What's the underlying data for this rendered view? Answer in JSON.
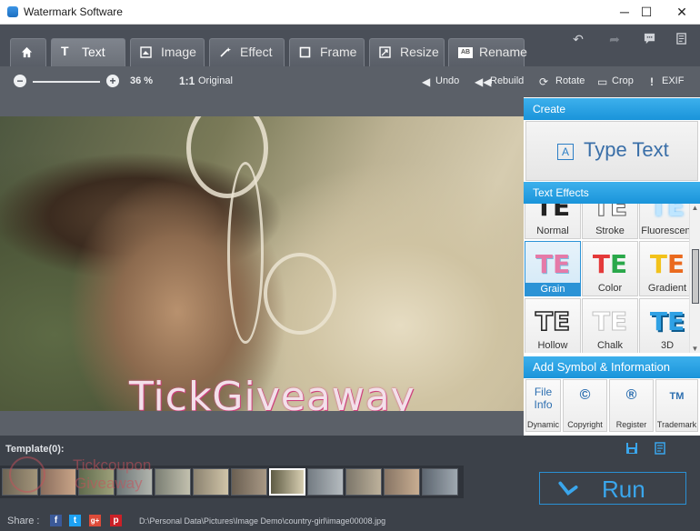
{
  "window": {
    "title": "Watermark Software",
    "minimize": "─",
    "maximize": "☐",
    "close": "✕"
  },
  "tabs": [
    {
      "label": "Text"
    },
    {
      "label": "Image"
    },
    {
      "label": "Effect"
    },
    {
      "label": "Frame"
    },
    {
      "label": "Resize"
    },
    {
      "label": "Rename"
    }
  ],
  "toolbar": {
    "zoom_percent": "36 %",
    "original_icon": "1:1",
    "original": "Original",
    "undo": "Undo",
    "rebuild": "Rebuild",
    "rotate": "Rotate",
    "crop": "Crop",
    "exif": "EXIF"
  },
  "canvas": {
    "watermark_text": "TickGiveaway"
  },
  "panel": {
    "create_head": "Create",
    "type_text_icon": "A",
    "type_text": "Type Text",
    "effects_head": "Text Effects",
    "effect_glyph": "TE",
    "effects": [
      {
        "label": "Normal"
      },
      {
        "label": "Stroke"
      },
      {
        "label": "Fluorescent"
      },
      {
        "label": "Grain"
      },
      {
        "label": "Color"
      },
      {
        "label": "Gradient"
      },
      {
        "label": "Hollow"
      },
      {
        "label": "Chalk"
      },
      {
        "label": "3D"
      }
    ],
    "symbol_head": "Add Symbol & Information",
    "symbols": [
      {
        "glyph": "File Info",
        "label": "Dynamic"
      },
      {
        "glyph": "©",
        "label": "Copyright"
      },
      {
        "glyph": "®",
        "label": "Register"
      },
      {
        "glyph": "TM",
        "label": "Trademark"
      }
    ]
  },
  "bottom": {
    "template_label": "Template(0):",
    "run": "Run",
    "share": "Share :",
    "social": [
      "f",
      "t",
      "g+",
      "p"
    ],
    "file_path": "D:\\Personal Data\\Pictures\\Image Demo\\country-girl\\image00008.jpg",
    "logo_line1": "Tickcoupon",
    "logo_line2": "Giveaway"
  },
  "colors": {
    "accent": "#1a94da",
    "tab_bg": "#4a4f58",
    "toolbar_bg": "#5b6068"
  }
}
